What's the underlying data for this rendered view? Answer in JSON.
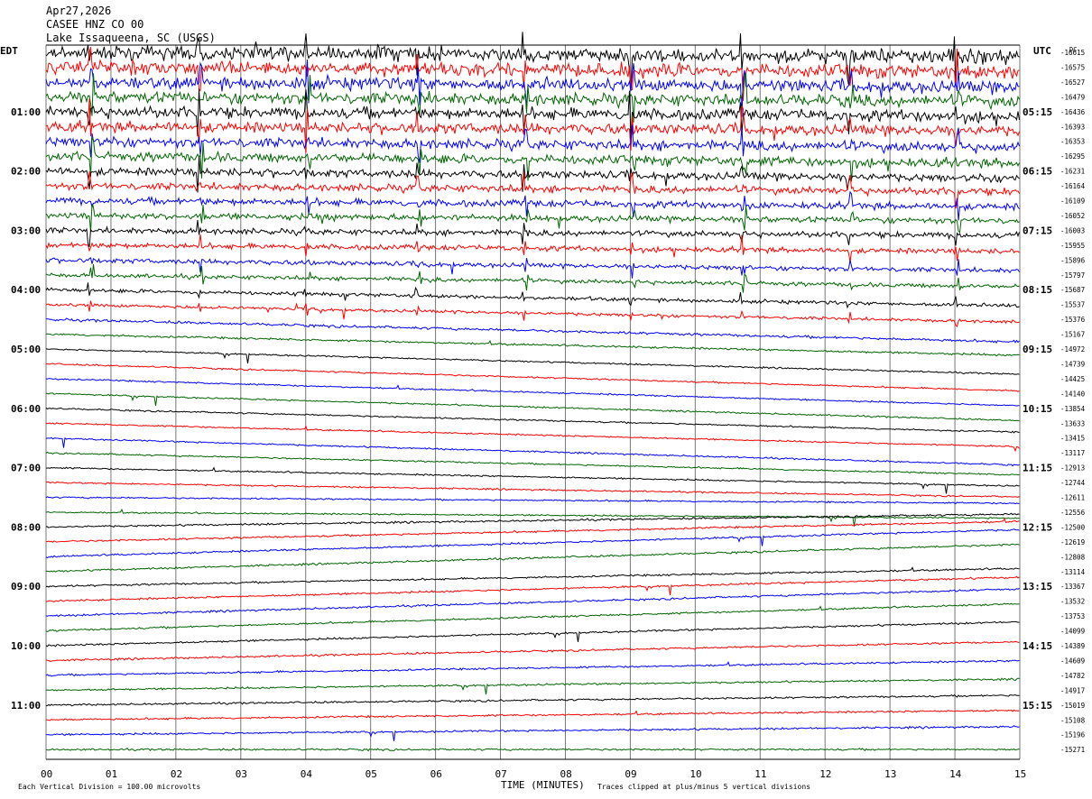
{
  "header": {
    "date": "Apr27,2026",
    "channel": "CASEE HNZ CO 00",
    "location": "Lake Issaqueena, SC (USGS)",
    "left_timezone": "EDT",
    "right_timezone": "UTC",
    "dc_label": "DC"
  },
  "footer": {
    "scale_note": "Each Vertical Division =  100.00 microvolts",
    "x_axis_title": "TIME (MINUTES)",
    "clip_note": "Traces clipped at plus/minus 5 vertical divisions"
  },
  "chart_data": {
    "type": "line",
    "title": "Apr27,2026",
    "subtitle": "CASEE HNZ CO 00 Lake Issaqueena, SC (USGS)",
    "xlabel": "TIME (MINUTES)",
    "ylabel": "",
    "xlim": [
      0,
      15
    ],
    "x_ticks": [
      "00",
      "01",
      "02",
      "03",
      "04",
      "05",
      "06",
      "07",
      "08",
      "09",
      "10",
      "11",
      "12",
      "13",
      "14",
      "15"
    ],
    "grid": "vertical lines at each minute",
    "trace_colors": [
      "#000000",
      "#ff0000",
      "#0000ff",
      "#006400"
    ],
    "left_hour_labels": [
      "01:00",
      "02:00",
      "03:00",
      "04:00",
      "05:00",
      "06:00",
      "07:00",
      "08:00",
      "09:00",
      "10:00",
      "11:00"
    ],
    "right_hour_labels": [
      "05:15",
      "06:15",
      "07:15",
      "08:15",
      "09:15",
      "10:15",
      "11:15",
      "12:15",
      "13:15",
      "14:15",
      "15:15"
    ],
    "dc_offsets": [
      -16615,
      -16575,
      -16527,
      -16479,
      -16436,
      -16393,
      -16353,
      -16295,
      -16231,
      -16164,
      -16109,
      -16052,
      -16003,
      -15955,
      -15896,
      -15797,
      -15687,
      -15537,
      -15376,
      -15167,
      -14972,
      -14739,
      -14425,
      -14140,
      -13854,
      -13633,
      -13415,
      -13117,
      -12913,
      -12744,
      -12611,
      -12556,
      -12500,
      -12619,
      -12808,
      -13114,
      -13367,
      -13532,
      -13753,
      -14099,
      -14389,
      -14609,
      -14782,
      -14917,
      -15019,
      -15108,
      -15196,
      -15271
    ]
  }
}
